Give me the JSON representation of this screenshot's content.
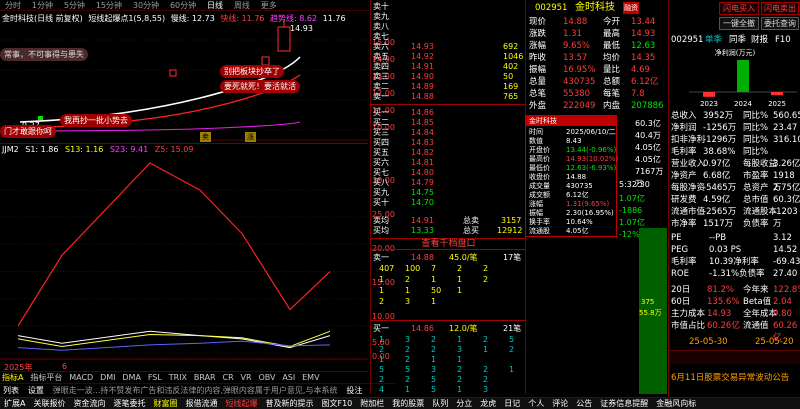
{
  "top_tabs": [
    "分时",
    "1分钟",
    "5分钟",
    "15分钟",
    "30分钟",
    "60分钟",
    "日线",
    "周线",
    "更多"
  ],
  "k_legend": {
    "name": "金时科技(日线 前复权)",
    "ind": "短线起爆点1(5,8,55)",
    "l1": "慢线: 12.73",
    "l2": "快线: 11.76",
    "l3": "趋势线: 8.62",
    "l4": "11.76"
  },
  "main_chart": {
    "axis": [
      "15.00",
      "14.00",
      "13.00",
      "12.00",
      "11.00",
      "10.00",
      "9.00"
    ],
    "peak": "14.93",
    "low": "9.27",
    "labels": [
      "常事，不可事得与患失",
      "门才敢跟你呵",
      "我再抄一批小势去",
      "别把板块抄卒了",
      "要死就死！要活就活"
    ],
    "bs": [
      "卖",
      "涨"
    ]
  },
  "ind_legend": {
    "name": "JJM2",
    "s1": "S1: 1.86",
    "s2": "S13: 1.16",
    "s3": "S23: 9.41",
    "s4": "Z5: 15.09"
  },
  "ind_chart": {
    "axis": [
      "30.00",
      "25.00",
      "20.00",
      "15.00",
      "10.00",
      "5.00",
      "0.00"
    ],
    "red": [
      5,
      18,
      35,
      30,
      22,
      8,
      15
    ],
    "white": [
      3.2,
      1.8,
      4.0,
      3.2,
      2.6,
      1.0,
      3.2
    ],
    "yellow": [
      2.6,
      1.2,
      3.4,
      3.2,
      2.8,
      1.2,
      4.0
    ],
    "blue": [
      1.0,
      0.5,
      1.5,
      1.8,
      2.2,
      1.3,
      1.5
    ],
    "xlabel": "2025年",
    "xlabel2": "6"
  },
  "bottom_tabs": [
    "指标A",
    "指标平台",
    "MACD",
    "DMI",
    "DMA",
    "FSL",
    "TRIX",
    "BRAR",
    "CR",
    "VR",
    "OBV",
    "ASI",
    "EMV"
  ],
  "toolbar": [
    "列表",
    "设置",
    "弹眼走一波...持不赞发布广告和违反法律的内容,弹眼内容属于用户意见,与本系统",
    "投注"
  ],
  "status": [
    "扩展A",
    "关联报价",
    "资金流向",
    "逐笔委托",
    "财富圈",
    "报借流通",
    "短线起爆",
    "普及新的提示",
    "图文F10",
    "附加栏",
    "我的股票",
    "队列",
    "分立",
    "龙虎",
    "日记",
    "个人",
    "评论",
    "公告",
    "证券信息提醒",
    "金融风向标"
  ],
  "orderbook": {
    "sells": [
      {
        "l": "卖十",
        "p": "",
        "v": ""
      },
      {
        "l": "卖九",
        "p": "",
        "v": ""
      },
      {
        "l": "卖八",
        "p": "",
        "v": ""
      },
      {
        "l": "卖七",
        "p": "",
        "v": ""
      },
      {
        "l": "卖六",
        "p": "14.93",
        "v": "692"
      },
      {
        "l": "卖五",
        "p": "14.92",
        "v": "1046"
      },
      {
        "l": "卖四",
        "p": "14.91",
        "v": "402"
      },
      {
        "l": "卖三",
        "p": "14.90",
        "v": "50"
      },
      {
        "l": "卖二",
        "p": "14.89",
        "v": "169"
      },
      {
        "l": "卖一",
        "p": "14.88",
        "v": "765"
      }
    ],
    "buys": [
      {
        "l": "买一",
        "p": "14.86",
        "v": ""
      },
      {
        "l": "买二",
        "p": "14.85",
        "v": ""
      },
      {
        "l": "买三",
        "p": "14.84",
        "v": ""
      },
      {
        "l": "买四",
        "p": "14.83",
        "v": ""
      },
      {
        "l": "买五",
        "p": "14.82",
        "v": ""
      },
      {
        "l": "买六",
        "p": "14.81",
        "v": ""
      },
      {
        "l": "买七",
        "p": "14.80",
        "v": ""
      },
      {
        "l": "买八",
        "p": "14.79",
        "v": ""
      },
      {
        "l": "买九",
        "p": "14.75",
        "v": ""
      },
      {
        "l": "买十",
        "p": "14.70",
        "v": ""
      }
    ],
    "avg_sell": {
      "l": "卖均",
      "p": "14.91",
      "t": "总卖",
      "v": "3157"
    },
    "avg_buy": {
      "l": "买均",
      "p": "13.33",
      "t": "总买",
      "v": "12912"
    },
    "queue_title": "查看千档盘口",
    "q_sell": {
      "l": "卖一",
      "p": "14.88",
      "a": "45.0/笔",
      "b": "17笔"
    },
    "q_sell_rows": [
      [
        "407",
        "100",
        "7",
        "2",
        "2"
      ],
      [
        "1",
        "2",
        "1",
        "1",
        "2"
      ],
      [
        "1",
        "1",
        "50",
        "1"
      ],
      [
        "2",
        "3",
        "1"
      ]
    ],
    "q_buy": {
      "l": "买一",
      "p": "14.86",
      "a": "12.0/笔",
      "b": "21笔"
    },
    "q_buy_rows": [
      [
        "1",
        "3",
        "2",
        "1",
        "2",
        "5"
      ],
      [
        "2",
        "2",
        "2",
        "3",
        "1",
        "2"
      ],
      [
        "1",
        "2",
        "1",
        "1"
      ],
      [
        "5",
        "5",
        "3",
        "2",
        "2",
        "1"
      ],
      [
        "2",
        "2",
        "5",
        "2",
        "2"
      ],
      [
        "4",
        "1",
        "5",
        "1",
        "3"
      ]
    ]
  },
  "quote": {
    "code": "002951",
    "name": "金时科技",
    "tag": "融资",
    "rows": [
      [
        "现价",
        "14.88",
        "今开",
        "13.44"
      ],
      [
        "涨跌",
        "1.31",
        "最高",
        "14.93"
      ],
      [
        "涨幅",
        "9.65%",
        "最低",
        "12.63"
      ],
      [
        "昨收",
        "13.57",
        "均价",
        "14.35"
      ],
      [
        "振幅",
        "16.95%",
        "量比",
        "4.69"
      ],
      [
        "总量",
        "430735",
        "总额",
        "6.12亿"
      ],
      [
        "总笔",
        "55380",
        "每笔",
        "7.8"
      ],
      [
        "外盘",
        "222049",
        "内盘",
        "207886"
      ]
    ],
    "mid": [
      "60.3亿",
      "40.4万",
      "4.05亿",
      "4.05亿",
      "7167万",
      "万"
    ],
    "time": "5:32:30",
    "ticks": [
      [
        "1.07亿",
        "-1886"
      ],
      [
        "1.07亿",
        "-12%"
      ]
    ],
    "vol_box": "375",
    "vol_box2": "55.8万"
  },
  "popup": {
    "title": "金时科技",
    "rows": [
      [
        "时间",
        "2025/06/10/二"
      ],
      [
        "数值",
        "8.43"
      ],
      [
        "开盘价",
        "13.44(-0.96%)"
      ],
      [
        "最高价",
        "14.93(10.02%)"
      ],
      [
        "最低价",
        "12.63(-6.93%)"
      ],
      [
        "收盘价",
        "14.88"
      ],
      [
        "成交量",
        "430735"
      ],
      [
        "成交额",
        "6.12亿"
      ],
      [
        "涨幅",
        "1.31(9.65%)"
      ],
      [
        "振幅",
        "2.30(16.95%)"
      ],
      [
        "换手率",
        "10.64%"
      ],
      [
        "流通股",
        "4.05亿"
      ]
    ]
  },
  "right_panel": {
    "btns": [
      "闪电买入",
      "闪电卖出",
      "一键全撤",
      "委托查询"
    ],
    "code": "002951",
    "tabs": [
      "单季",
      "同季",
      "财报",
      "F10"
    ],
    "bar_title": "净利润(万元)",
    "bar_years": [
      "2023",
      "2024",
      "2025"
    ],
    "bar_values": [
      -0.6,
      4.0,
      -0.4
    ],
    "fin": [
      [
        "总收入",
        "3952万",
        "同比%",
        "560.65"
      ],
      [
        "净利润",
        "-1256万",
        "同比%",
        "23.47"
      ],
      [
        "扣非净利",
        "-1296万",
        "同比%",
        "316.10"
      ],
      [
        "毛利率",
        "38.68%",
        "同比%",
        ""
      ],
      [
        "营业收入",
        "0.97亿",
        "每股收益",
        "3.26亿"
      ],
      [
        "净资产",
        "6.68亿",
        "市盈率",
        "1918万"
      ],
      [
        "每股净资",
        "-5465万",
        "总资产",
        "2.75亿"
      ],
      [
        "研发费",
        "4.59亿",
        "总市值",
        "60.3亿"
      ],
      [
        "流通市值",
        "-2565万",
        "流通股本",
        "-1203万"
      ],
      [
        "市净率",
        "1517万",
        "负债率",
        ""
      ]
    ],
    "val": [
      [
        "PE",
        "--PB",
        "3.12"
      ],
      [
        "PEG",
        "0.03 PS",
        "14.52"
      ],
      [
        "毛利率",
        "10.39净利率",
        "-69.43"
      ],
      [
        "ROE",
        "-1.31%负债率",
        "27.40"
      ]
    ],
    "perf": [
      [
        "20日",
        "81.2%",
        "今年来",
        "122.8%"
      ],
      [
        "60日",
        "135.6%",
        "Beta值",
        "2.04"
      ],
      [
        "主力成本",
        "14.93",
        "全年成本",
        "9.80"
      ],
      [
        "市值占比",
        "60.26亿",
        "流通值",
        "60.26亿"
      ]
    ],
    "dates": [
      "25-05-30",
      "25-05-20"
    ],
    "info": "6月11日股票交易异常波动公告"
  }
}
